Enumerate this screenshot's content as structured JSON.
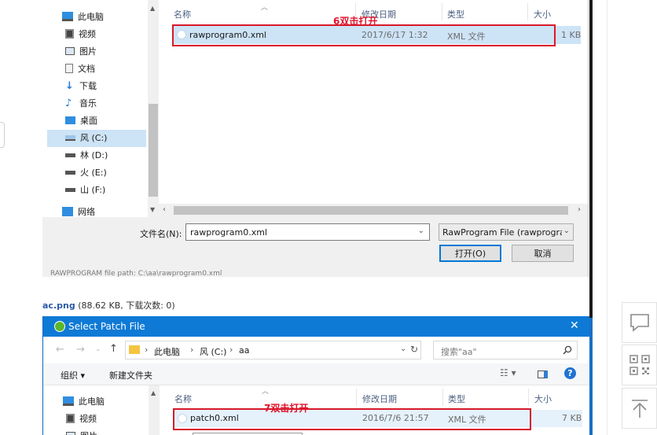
{
  "dialog1": {
    "nav": [
      "此电脑",
      "视频",
      "图片",
      "文档",
      "下载",
      "音乐",
      "桌面",
      "风 (C:)",
      "林 (D:)",
      "火 (E:)",
      "山 (F:)",
      "网络"
    ],
    "columns": {
      "name": "名称",
      "date": "修改日期",
      "type": "类型",
      "size": "大小"
    },
    "file": {
      "name": "rawprogram0.xml",
      "date": "2017/6/17 1:32",
      "type": "XML 文件",
      "size": "1 KB"
    },
    "annotation": "6双击打开",
    "filename_label": "文件名(N):",
    "filename_value": "rawprogram0.xml",
    "filter": "RawProgram File (rawprogra",
    "open_button": "打开(O)",
    "cancel_button": "取消",
    "under_text": "RAWPROGRAM file path: C:\\aa\\rawprogram0.xml"
  },
  "caption": {
    "link": "ac.png",
    "info": " (88.62 KB, 下载次数: 0)"
  },
  "dialog2": {
    "title": "Select Patch File",
    "path": [
      "此电脑",
      "风 (C:)",
      "aa"
    ],
    "search_placeholder": "搜索\"aa\"",
    "organize": "组织 ▾",
    "new_folder": "新建文件夹",
    "nav": [
      "此电脑",
      "视频",
      "图片"
    ],
    "columns": {
      "name": "名称",
      "date": "修改日期",
      "type": "类型",
      "size": "大小"
    },
    "file": {
      "name": "patch0.xml",
      "date": "2016/7/6 21:57",
      "type": "XML 文件",
      "size": "7 KB"
    },
    "annotation": "7双击打开"
  },
  "colors": {
    "annotation_red": "#d9182a",
    "title_blue": "#0e7ad6",
    "selection": "#cde3f6"
  }
}
